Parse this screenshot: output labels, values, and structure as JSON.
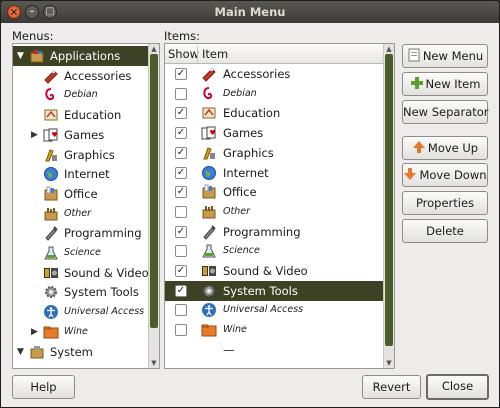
{
  "window": {
    "title": "Main Menu"
  },
  "menus": {
    "label": "Menus:",
    "tree": [
      {
        "label": "Applications",
        "level": 0,
        "expanded": true,
        "selected": true,
        "icon": "applications-icon",
        "italic": false
      },
      {
        "label": "Accessories",
        "level": 1,
        "icon": "accessories-icon",
        "italic": false
      },
      {
        "label": "Debian",
        "level": 1,
        "icon": "debian-icon",
        "italic": true
      },
      {
        "label": "Education",
        "level": 1,
        "icon": "education-icon",
        "italic": false
      },
      {
        "label": "Games",
        "level": 1,
        "icon": "games-icon",
        "italic": false,
        "collapsed": true
      },
      {
        "label": "Graphics",
        "level": 1,
        "icon": "graphics-icon",
        "italic": false
      },
      {
        "label": "Internet",
        "level": 1,
        "icon": "internet-icon",
        "italic": false
      },
      {
        "label": "Office",
        "level": 1,
        "icon": "office-icon",
        "italic": false
      },
      {
        "label": "Other",
        "level": 1,
        "icon": "other-icon",
        "italic": true
      },
      {
        "label": "Programming",
        "level": 1,
        "icon": "programming-icon",
        "italic": false
      },
      {
        "label": "Science",
        "level": 1,
        "icon": "science-icon",
        "italic": true
      },
      {
        "label": "Sound & Video",
        "level": 1,
        "icon": "sound-video-icon",
        "italic": false
      },
      {
        "label": "System Tools",
        "level": 1,
        "icon": "system-tools-icon",
        "italic": false
      },
      {
        "label": "Universal Access",
        "level": 1,
        "icon": "universal-access-icon",
        "italic": true
      },
      {
        "label": "Wine",
        "level": 1,
        "icon": "wine-icon",
        "italic": true,
        "collapsed": true
      },
      {
        "label": "System",
        "level": 0,
        "expanded": true,
        "icon": "system-icon",
        "italic": false
      }
    ]
  },
  "items": {
    "label": "Items:",
    "columns": [
      "Show",
      "Item"
    ],
    "rows": [
      {
        "label": "Accessories",
        "checked": true,
        "icon": "accessories-icon",
        "italic": false
      },
      {
        "label": "Debian",
        "checked": false,
        "icon": "debian-icon",
        "italic": true
      },
      {
        "label": "Education",
        "checked": true,
        "icon": "education-icon",
        "italic": false
      },
      {
        "label": "Games",
        "checked": true,
        "icon": "games-icon",
        "italic": false
      },
      {
        "label": "Graphics",
        "checked": true,
        "icon": "graphics-icon",
        "italic": false
      },
      {
        "label": "Internet",
        "checked": true,
        "icon": "internet-icon",
        "italic": false
      },
      {
        "label": "Office",
        "checked": true,
        "icon": "office-icon",
        "italic": false
      },
      {
        "label": "Other",
        "checked": false,
        "icon": "other-icon",
        "italic": true
      },
      {
        "label": "Programming",
        "checked": true,
        "icon": "programming-icon",
        "italic": false
      },
      {
        "label": "Science",
        "checked": false,
        "icon": "science-icon",
        "italic": true
      },
      {
        "label": "Sound & Video",
        "checked": true,
        "icon": "sound-video-icon",
        "italic": false
      },
      {
        "label": "System Tools",
        "checked": true,
        "icon": "system-tools-icon",
        "italic": false,
        "selected": true
      },
      {
        "label": "Universal Access",
        "checked": false,
        "icon": "universal-access-icon",
        "italic": true
      },
      {
        "label": "Wine",
        "checked": false,
        "icon": "wine-icon",
        "italic": true
      },
      {
        "label": "—",
        "checked": false,
        "icon": "",
        "italic": false,
        "no_checkbox": true
      }
    ]
  },
  "buttons": {
    "new_menu": "New Menu",
    "new_item": "New Item",
    "new_separator": "New Separator",
    "move_up": "Move Up",
    "move_down": "Move Down",
    "properties": "Properties",
    "delete": "Delete",
    "help": "Help",
    "revert": "Revert",
    "close": "Close"
  },
  "colors": {
    "selection": "#3d4224",
    "titlebar": "#3c3b37",
    "accent": "#4b5d2a"
  }
}
